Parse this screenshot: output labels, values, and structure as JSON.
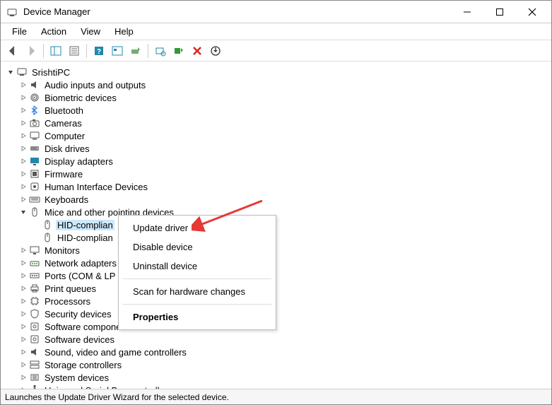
{
  "titlebar": {
    "title": "Device Manager"
  },
  "menubar": {
    "items": [
      "File",
      "Action",
      "View",
      "Help"
    ]
  },
  "tree": {
    "root": "SrishtiPC",
    "nodes": [
      {
        "label": "Audio inputs and outputs",
        "icon": "speaker"
      },
      {
        "label": "Biometric devices",
        "icon": "fingerprint"
      },
      {
        "label": "Bluetooth",
        "icon": "bluetooth"
      },
      {
        "label": "Cameras",
        "icon": "camera"
      },
      {
        "label": "Computer",
        "icon": "computer"
      },
      {
        "label": "Disk drives",
        "icon": "disk"
      },
      {
        "label": "Display adapters",
        "icon": "display"
      },
      {
        "label": "Firmware",
        "icon": "firmware"
      },
      {
        "label": "Human Interface Devices",
        "icon": "hid"
      },
      {
        "label": "Keyboards",
        "icon": "keyboard"
      },
      {
        "label": "Mice and other pointing devices",
        "icon": "mouse",
        "expanded": true,
        "children": [
          {
            "label": "HID-complian",
            "icon": "mouse",
            "selected": true
          },
          {
            "label": "HID-complian",
            "icon": "mouse"
          }
        ]
      },
      {
        "label": "Monitors",
        "icon": "monitor"
      },
      {
        "label": "Network adapters",
        "icon": "network"
      },
      {
        "label": "Ports (COM & LP",
        "icon": "port"
      },
      {
        "label": "Print queues",
        "icon": "printer"
      },
      {
        "label": "Processors",
        "icon": "cpu"
      },
      {
        "label": "Security devices",
        "icon": "security"
      },
      {
        "label": "Software components",
        "icon": "software"
      },
      {
        "label": "Software devices",
        "icon": "software"
      },
      {
        "label": "Sound, video and game controllers",
        "icon": "speaker"
      },
      {
        "label": "Storage controllers",
        "icon": "storage"
      },
      {
        "label": "System devices",
        "icon": "system"
      },
      {
        "label": "Universal Serial Bus controllers",
        "icon": "usb"
      }
    ]
  },
  "context_menu": {
    "items": [
      {
        "label": "Update driver"
      },
      {
        "label": "Disable device"
      },
      {
        "label": "Uninstall device"
      },
      {
        "sep": true
      },
      {
        "label": "Scan for hardware changes"
      },
      {
        "sep": true
      },
      {
        "label": "Properties",
        "bold": true
      }
    ]
  },
  "statusbar": {
    "text": "Launches the Update Driver Wizard for the selected device."
  }
}
